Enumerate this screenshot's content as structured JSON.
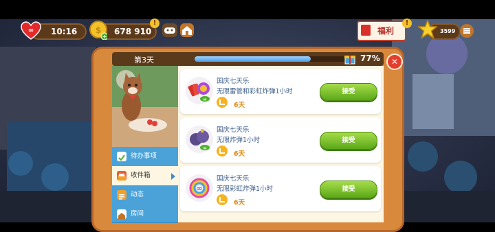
{
  "hud": {
    "lives_time": "10:16",
    "coins": "678 910",
    "welfare_label": "福利",
    "stars": "3599"
  },
  "panel": {
    "day_label": "第3天",
    "progress_text": "77%",
    "progress_fraction": 0.77,
    "close_glyph": "✕"
  },
  "sidebar": {
    "items": [
      {
        "label": "待办事项",
        "icon": "checklist-icon"
      },
      {
        "label": "收件箱",
        "icon": "mailbox-icon",
        "active": true
      },
      {
        "label": "动态",
        "icon": "news-icon"
      },
      {
        "label": "房间",
        "icon": "room-icon"
      }
    ]
  },
  "cards": [
    {
      "title": "国庆七天乐",
      "desc": "无限雷管和彩虹炸弹1小时",
      "days": "6天",
      "button": "接受",
      "reward_icon": "tnt-rainbow-infinite-icon"
    },
    {
      "title": "国庆七天乐",
      "desc": "无限炸弹1小时",
      "days": "6天",
      "button": "接受",
      "reward_icon": "bomb-infinite-icon"
    },
    {
      "title": "国庆七天乐",
      "desc": "无限彩虹炸弹1小时",
      "days": "6天",
      "button": "接受",
      "reward_icon": "rainbow-infinite-icon"
    }
  ],
  "colors": {
    "accept_button": "#5aa818",
    "day_text": "#e08a10",
    "title_text": "#3b5c8a"
  }
}
